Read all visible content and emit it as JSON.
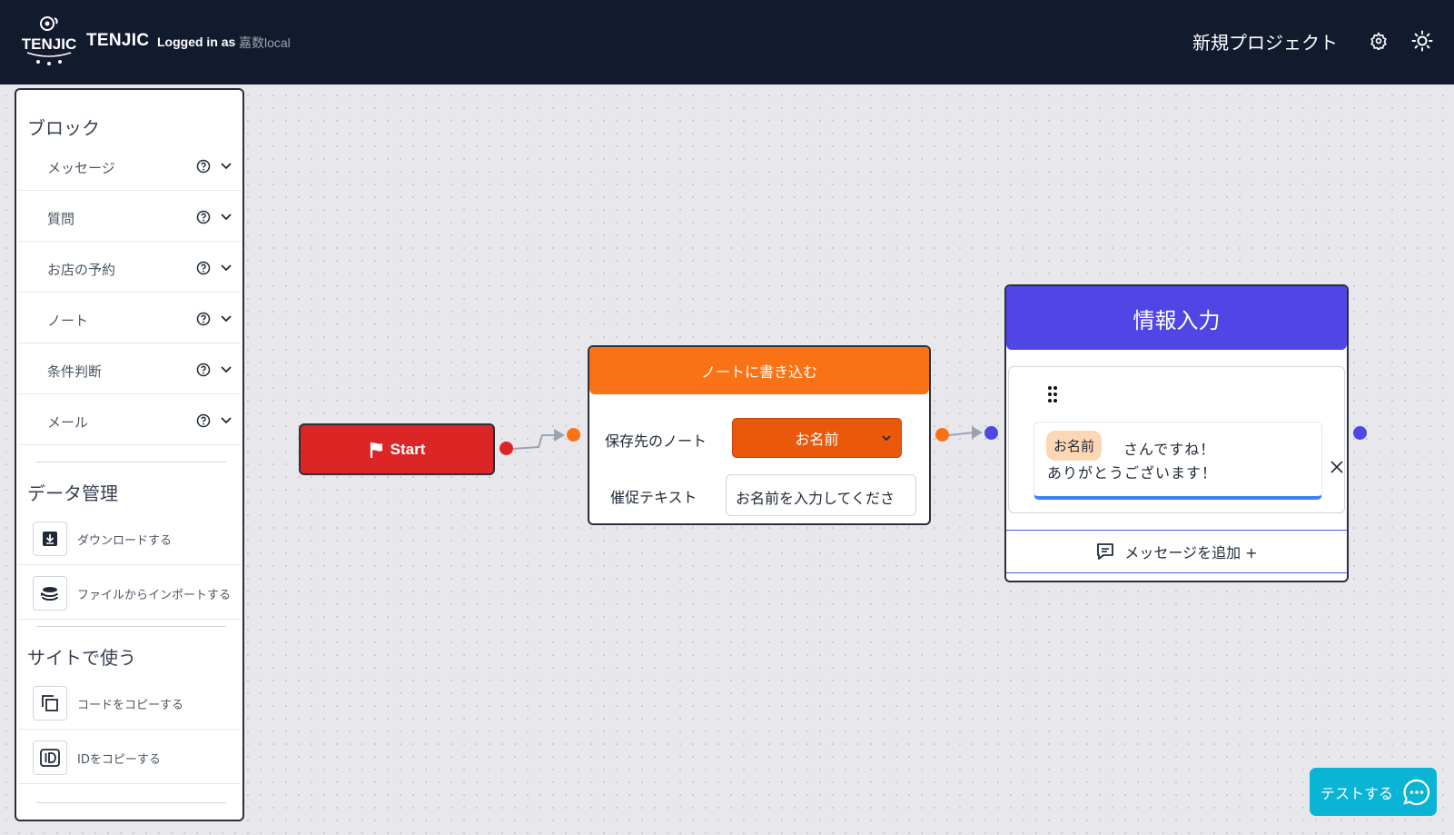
{
  "header": {
    "brand": "TENJIC",
    "logo_text": "TENJIC",
    "login_label": "Logged in as",
    "login_user": "嘉数local",
    "project_title": "新規プロジェクト",
    "icons": [
      "gear-icon",
      "sun-icon"
    ]
  },
  "sidebar": {
    "blocks_title": "ブロック",
    "blocks": [
      {
        "label": "メッセージ"
      },
      {
        "label": "質問"
      },
      {
        "label": "お店の予約"
      },
      {
        "label": "ノート"
      },
      {
        "label": "条件判断"
      },
      {
        "label": "メール"
      }
    ],
    "data_title": "データ管理",
    "data_actions": [
      {
        "label": "ダウンロードする",
        "icon": "download-icon"
      },
      {
        "label": "ファイルからインポートする",
        "icon": "import-icon"
      }
    ],
    "site_title": "サイトで使う",
    "site_actions": [
      {
        "label": "コードをコピーする",
        "icon": "copy-icon"
      },
      {
        "label": "IDをコピーする",
        "icon": "id-icon"
      }
    ]
  },
  "canvas": {
    "start_node": {
      "label": "Start",
      "color": "#dc2626"
    },
    "note_node": {
      "title": "ノートに書き込む",
      "save_label": "保存先のノート",
      "save_value": "お名前",
      "prompt_label": "催促テキスト",
      "prompt_value": "お名前を入力してくださ",
      "color": "#f97316"
    },
    "info_node": {
      "title": "情報入力",
      "variable_chip": "お名前",
      "message_line1": "さんですね！",
      "message_line2": "ありがとうございます！",
      "add_message_label": "メッセージを追加 +",
      "color": "#4f46e5"
    }
  },
  "test_button": {
    "label": "テストする",
    "color": "#0ab4d4"
  }
}
